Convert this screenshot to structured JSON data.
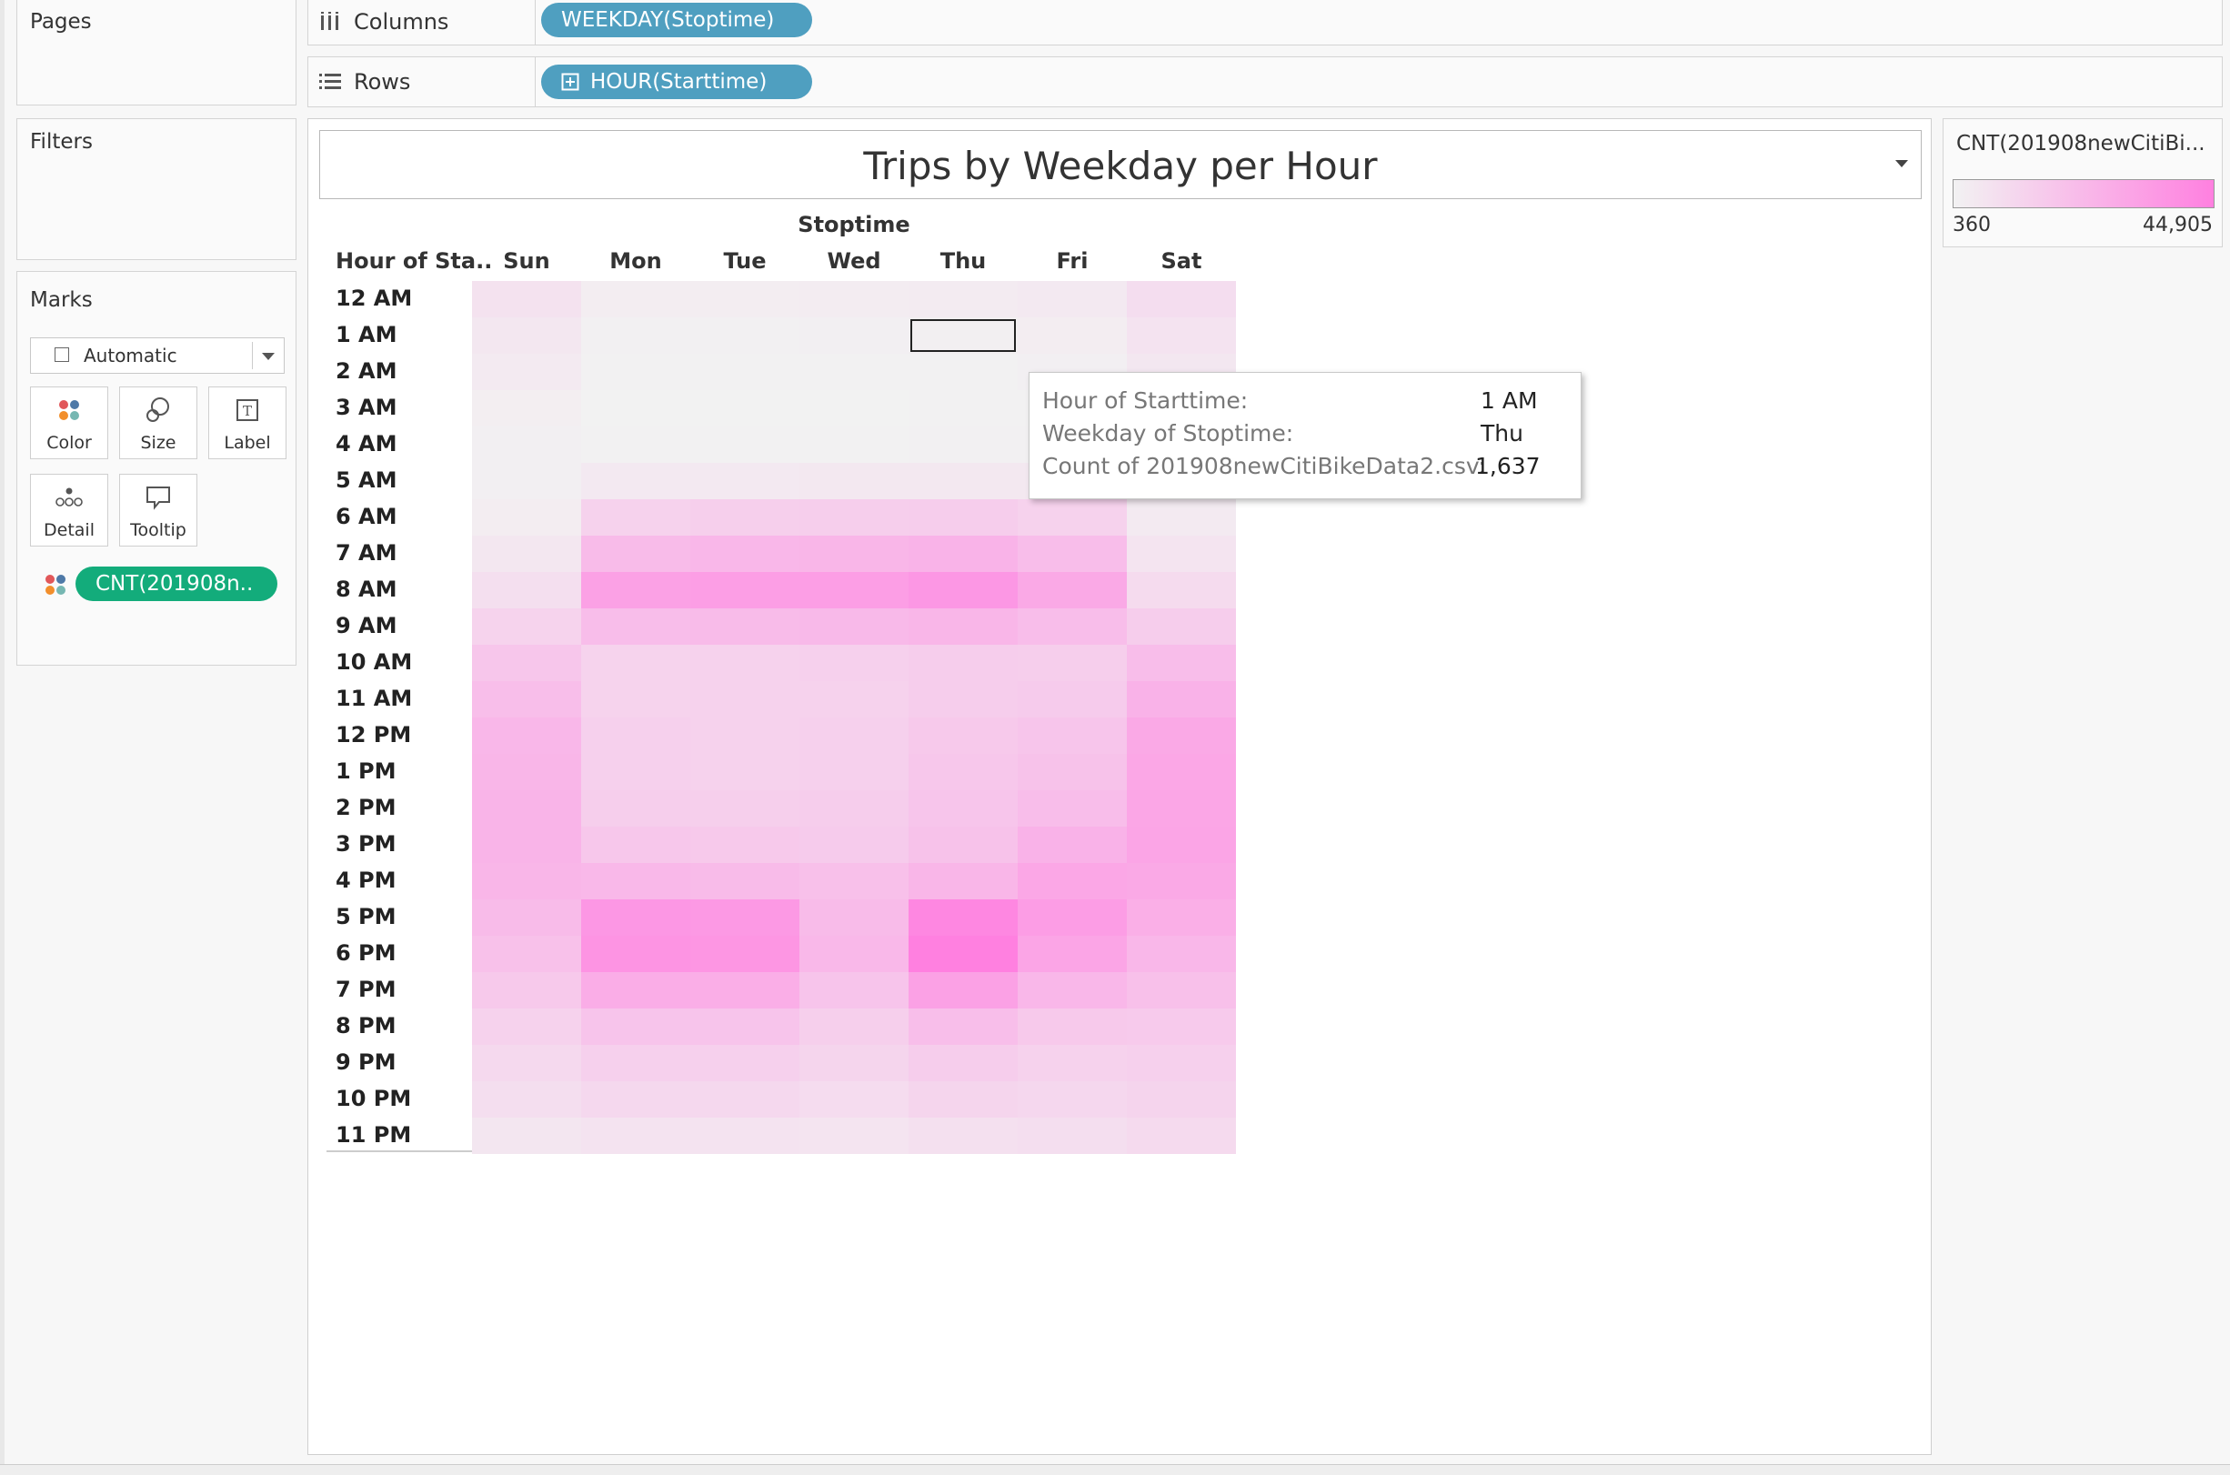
{
  "shelves": {
    "pages_label": "Pages",
    "columns_label": "Columns",
    "rows_label": "Rows",
    "columns_pill": "WEEKDAY(Stoptime)",
    "rows_pill": "HOUR(Starttime)"
  },
  "filters": {
    "label": "Filters"
  },
  "marks": {
    "label": "Marks",
    "mark_type": "Automatic",
    "cards": [
      "Color",
      "Size",
      "Label",
      "Detail",
      "Tooltip"
    ],
    "color_pill": "CNT(201908n.."
  },
  "legend": {
    "title": "CNT(201908newCitiBi...",
    "min_label": "360",
    "max_label": "44,905",
    "colors": {
      "low": "#f2f2f2",
      "high": "#ff80e0"
    }
  },
  "worksheet": {
    "title": "Trips by Weekday per Hour",
    "columns_header": "Stoptime",
    "rows_header": "Hour of Sta.."
  },
  "chart_data": {
    "type": "heatmap",
    "title": "Trips by Weekday per Hour",
    "xlabel": "Stoptime",
    "ylabel": "Hour of Sta..",
    "x": [
      "Sun",
      "Mon",
      "Tue",
      "Wed",
      "Thu",
      "Fri",
      "Sat"
    ],
    "y": [
      "12 AM",
      "1 AM",
      "2 AM",
      "3 AM",
      "4 AM",
      "5 AM",
      "6 AM",
      "7 AM",
      "8 AM",
      "9 AM",
      "10 AM",
      "11 AM",
      "12 PM",
      "1 PM",
      "2 PM",
      "3 PM",
      "4 PM",
      "5 PM",
      "6 PM",
      "7 PM",
      "8 PM",
      "9 PM",
      "10 PM",
      "11 PM"
    ],
    "color_range": [
      360,
      44905
    ],
    "values": [
      [
        6800,
        2200,
        2500,
        2700,
        3100,
        3900,
        8700
      ],
      [
        4600,
        1100,
        1200,
        1400,
        1637,
        2200,
        6400
      ],
      [
        3300,
        600,
        700,
        800,
        900,
        1400,
        4800
      ],
      [
        2100,
        400,
        450,
        500,
        600,
        900,
        3000
      ],
      [
        1500,
        800,
        850,
        900,
        950,
        1100,
        2000
      ],
      [
        1400,
        3800,
        4000,
        4200,
        4300,
        4100,
        1800
      ],
      [
        2500,
        13000,
        14000,
        14500,
        14800,
        13000,
        3500
      ],
      [
        4800,
        22000,
        23500,
        24000,
        25000,
        21000,
        6000
      ],
      [
        7900,
        32000,
        33000,
        33000,
        36000,
        29000,
        9500
      ],
      [
        12500,
        21000,
        22000,
        22500,
        24000,
        21000,
        15000
      ],
      [
        17500,
        12500,
        13000,
        13500,
        15000,
        14500,
        21000
      ],
      [
        20500,
        12500,
        12800,
        13000,
        15000,
        15500,
        25500
      ],
      [
        23500,
        13500,
        13000,
        13500,
        16500,
        18000,
        29000
      ],
      [
        24000,
        13500,
        12800,
        13800,
        17000,
        19000,
        29500
      ],
      [
        24500,
        14500,
        14000,
        15000,
        18000,
        21000,
        30000
      ],
      [
        24500,
        17000,
        16500,
        15500,
        19000,
        25500,
        30500
      ],
      [
        24000,
        23000,
        22000,
        20000,
        24000,
        29500,
        29000
      ],
      [
        22000,
        36000,
        35000,
        22000,
        42000,
        33500,
        26500
      ],
      [
        19500,
        37000,
        36500,
        23000,
        44905,
        30500,
        23500
      ],
      [
        16500,
        27500,
        27000,
        18500,
        32000,
        23500,
        20000
      ],
      [
        13000,
        18500,
        18500,
        14000,
        20500,
        16500,
        16000
      ],
      [
        10000,
        13500,
        13500,
        11500,
        15000,
        13000,
        13500
      ],
      [
        8000,
        10500,
        10500,
        9000,
        11500,
        11000,
        12000
      ],
      [
        5200,
        6200,
        6400,
        5800,
        7200,
        8000,
        9800
      ]
    ],
    "selected_cell": {
      "row": "1 AM",
      "col": "Thu"
    }
  },
  "tooltip": {
    "rows": [
      {
        "label": "Hour of Starttime:",
        "value": "1 AM"
      },
      {
        "label": "Weekday of Stoptime:",
        "value": "Thu"
      },
      {
        "label": "Count of 201908newCitiBikeData2.csv:",
        "value": "1,637"
      }
    ]
  }
}
